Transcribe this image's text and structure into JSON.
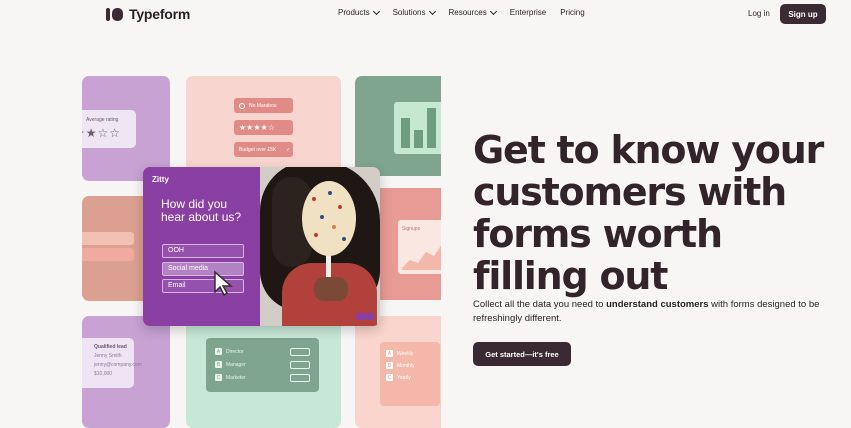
{
  "header": {
    "brand": "Typeform",
    "menu": [
      {
        "label": "Products",
        "has_dropdown": true
      },
      {
        "label": "Solutions",
        "has_dropdown": true
      },
      {
        "label": "Resources",
        "has_dropdown": true
      },
      {
        "label": "Enterprise",
        "has_dropdown": false
      },
      {
        "label": "Pricing",
        "has_dropdown": false
      }
    ],
    "login_label": "Log in",
    "signup_label": "Sign up"
  },
  "hero": {
    "title": "Get to know your customers with forms worth filling out",
    "subtitle_pre": "Collect all the data you need to ",
    "subtitle_bold": "understand customers",
    "subtitle_post": " with forms designed to be refreshingly different.",
    "cta_label": "Get started—it's free"
  },
  "collage": {
    "rating_card": {
      "label": "Average rating",
      "stars": "★★☆☆"
    },
    "pills": [
      "No Marabou",
      "★★★★☆",
      "Budget over £5K"
    ],
    "signups_label": "Signups",
    "lead_card": {
      "title": "Qualified lead",
      "name": "Jenny Smith",
      "email": "jenny@company.com",
      "value": "$10,000"
    },
    "roles": [
      {
        "key": "A",
        "label": "Director"
      },
      {
        "key": "B",
        "label": "Manager"
      },
      {
        "key": "C",
        "label": "Marketer"
      }
    ],
    "options_right": [
      {
        "key": "A",
        "label": "Weekly"
      },
      {
        "key": "B",
        "label": "Monthly"
      },
      {
        "key": "C",
        "label": "Yearly"
      }
    ],
    "zitty": {
      "brand": "Zitty",
      "question": "How did you hear about us?",
      "options": [
        "OOH",
        "Social media",
        "Email"
      ],
      "selected": "Social media"
    }
  },
  "colors": {
    "brand_dark": "#3b2a33",
    "purple": "#8a3fa3",
    "background": "#f8f6f5"
  }
}
